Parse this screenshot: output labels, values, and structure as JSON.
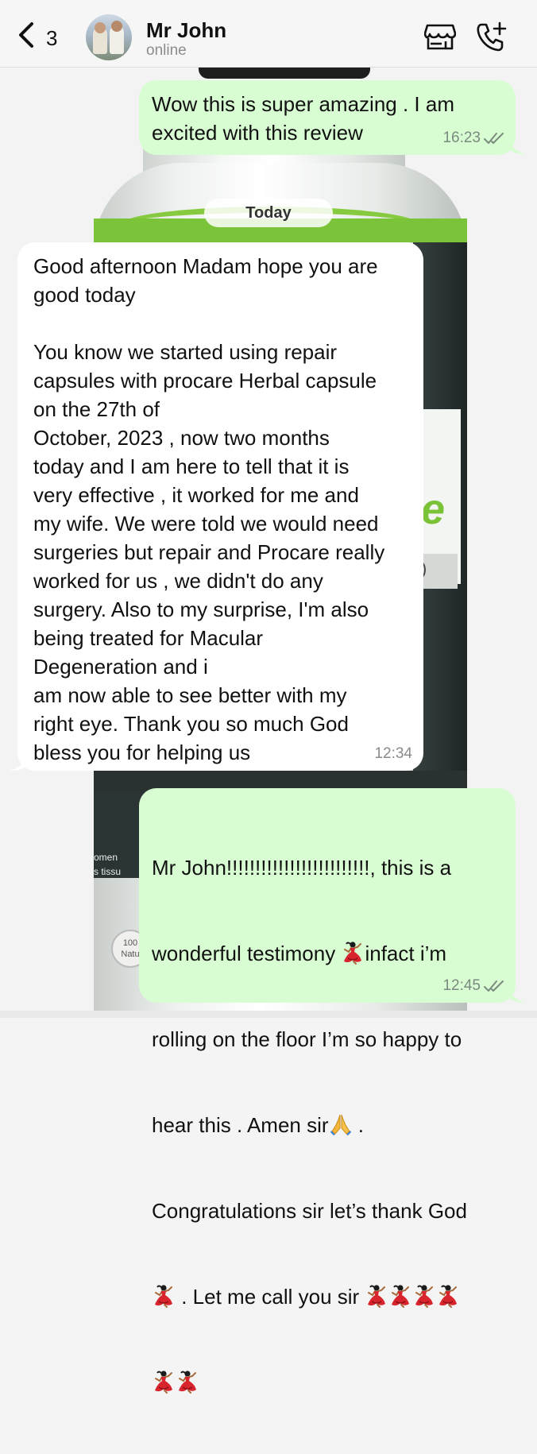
{
  "header": {
    "back_count": "3",
    "contact_name": "Mr John",
    "status": "online"
  },
  "day_separator": "Today",
  "messages": [
    {
      "direction": "outgoing",
      "text": "Wow this is super amazing . I am\nexcited with this review",
      "time": "16:23",
      "read": true
    },
    {
      "direction": "incoming",
      "text": "Good afternoon Madam hope you are\ngood today\n\nYou know we started using repair\ncapsules with procare Herbal capsule\non the 27th of\nOctober, 2023 , now two months\ntoday and I am here to tell that it is\nvery effective , it worked for me and\nmy wife. We were told we would need\nsurgeries but repair and Procare really\nworked for us , we didn't do any\nsurgery. Also to my surprise, I'm also\nbeing treated for Macular\nDegeneration and i\nam now able to see better with my\nright eye. Thank you so much God\nbless you for helping us",
      "time": "12:34"
    },
    {
      "direction": "outgoing",
      "lines": {
        "l1": "Mr John!!!!!!!!!!!!!!!!!!!!!!!!!, this is a",
        "l2a": "wonderful testimony ",
        "l2b": "infact i’m",
        "l3": "rolling on the floor I’m so happy to",
        "l4a": "hear this . Amen sir",
        "l4b": " .",
        "l5": "Congratulations sir let’s thank God",
        "l6": " . Let me call you sir "
      },
      "emoji": {
        "dancer": "woman-dancing-emoji",
        "pray": "folded-hands-emoji"
      },
      "time": "12:45",
      "read": true
    }
  ],
  "background": {
    "partial_label_letter": "e",
    "partial_tag": ")",
    "partial_side_text_1": "omen",
    "partial_side_text_2": "s tissu",
    "partial_badge_1": "100",
    "partial_badge_2": "Natu"
  },
  "colors": {
    "outgoing_bubble": "#d9fdd3",
    "incoming_bubble": "#ffffff",
    "read_ticks": "#7b8a7f"
  }
}
